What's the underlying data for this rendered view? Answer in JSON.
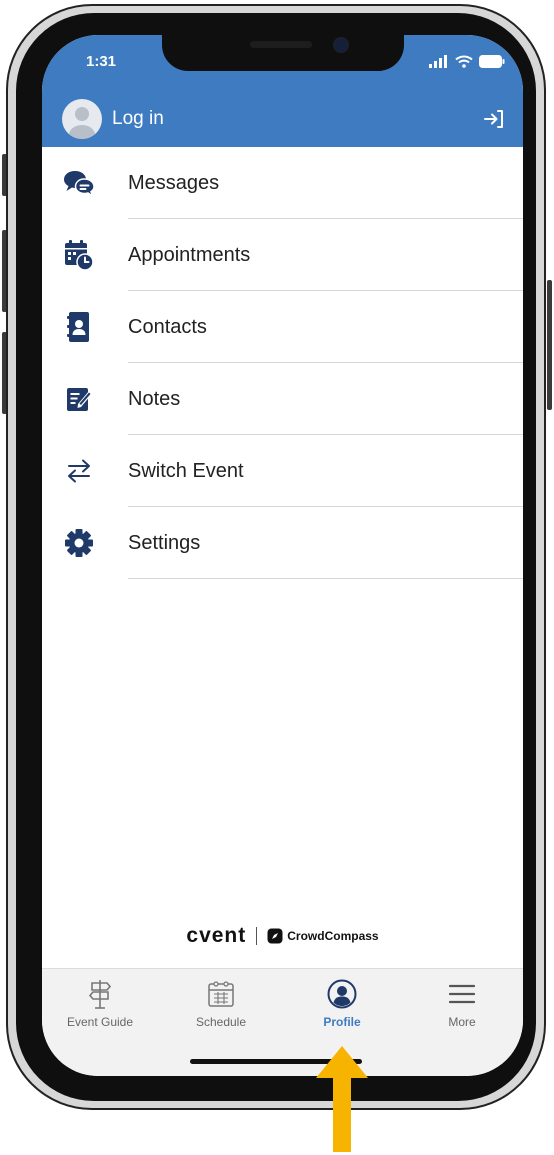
{
  "status_bar": {
    "time": "1:31"
  },
  "header": {
    "login_label": "Log in"
  },
  "menu": {
    "items": [
      {
        "label": "Messages",
        "icon": "messages-icon"
      },
      {
        "label": "Appointments",
        "icon": "appointments-icon"
      },
      {
        "label": "Contacts",
        "icon": "contacts-icon"
      },
      {
        "label": "Notes",
        "icon": "notes-icon"
      },
      {
        "label": "Switch Event",
        "icon": "switch-event-icon"
      },
      {
        "label": "Settings",
        "icon": "settings-icon"
      }
    ]
  },
  "branding": {
    "cvent": "cvent",
    "crowdcompass": "CrowdCompass"
  },
  "tabbar": {
    "tabs": [
      {
        "label": "Event Guide",
        "icon": "signpost-icon",
        "active": false
      },
      {
        "label": "Schedule",
        "icon": "calendar-icon",
        "active": false
      },
      {
        "label": "Profile",
        "icon": "profile-icon",
        "active": true
      },
      {
        "label": "More",
        "icon": "hamburger-icon",
        "active": false
      }
    ]
  },
  "colors": {
    "header_blue": "#3e7bc0",
    "icon_navy": "#1f3a68",
    "annotation_arrow": "#f6b400"
  }
}
